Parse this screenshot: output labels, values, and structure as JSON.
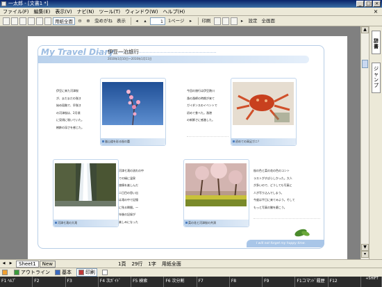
{
  "window": {
    "title": "一太郎 - [文書1 *]"
  },
  "menu": [
    "ファイル(F)",
    "編集(E)",
    "表示(V)",
    "ナビ(N)",
    "ツール(T)",
    "ウィンドウ(W)",
    "ヘルプ(H)"
  ],
  "toolbar": {
    "view_select": "用紙全面",
    "kana_search": "虫めがね",
    "display": "表示",
    "page_current": "1",
    "page_total": "1ページ",
    "print": "印刷",
    "settings": "設定",
    "full_screen": "全画面"
  },
  "side_panel": {
    "tab_dictionary": "辞書",
    "tab_jump": "ジャンプ"
  },
  "document": {
    "title": "My Travel Diary",
    "tagline": "I will not forget my happy time.",
    "subtitle": "伊豆一泊旅行",
    "date": "2010年1月10日～2010年1月11日",
    "blocks": [
      {
        "caption": "嵐山道を彩る桜の蕾",
        "text": [
          "伊豆に来た河津桜",
          "が、まだまだの咲き",
          "始め段階で、早咲き",
          "の河津桜は、2月頃",
          "に見頃に咲いていた。",
          "樹齢の深さを感じた。"
        ]
      },
      {
        "caption": "初めての高足ガニ？",
        "text": [
          "今回の旅行は伊豆熱川",
          "漁の漁師の時期が来て",
          "ガイダンスのイベントで",
          "初めて食べた。漁港",
          "の新鮮さに感激した。"
        ]
      },
      {
        "caption": "河津七滝の大滝",
        "text": [
          "河津七滝の流れの中",
          "での緑に温泉",
          "旅情を楽しんだ",
          "二日目の思い出",
          "は滝の中で記憶",
          "に残る瞬間。一",
          "年後の記録が",
          "楽しみになった"
        ]
      },
      {
        "caption": "菜の花と河津桜の共演",
        "text": [
          "桜の色と菜の花の色のコント",
          "ラストがすばらしかった。大人",
          "が多いので、どうしても写真に",
          "人が写り込んでしまう。",
          "今度は平日に来てみよう。そして",
          "もっと写真の腕を磨こう。"
        ]
      }
    ],
    "footer_tagline": "I will not forget my happy time."
  },
  "tabbar": {
    "sheet": "Sheet1",
    "new": "New",
    "status": [
      "1頁",
      "29行",
      "1字",
      "用紙全面"
    ]
  },
  "viewbar": [
    "アウトライン",
    "基本",
    "印刷"
  ],
  "fkeys": [
    "ﾍﾙﾌﾟ",
    "",
    "",
    "次ｶﾞｲﾄﾞ",
    "F5 検索",
    "F6 次分割",
    "",
    "",
    "",
    "F1コマﾝﾄﾞ履歴",
    "",
    "+SHIFT"
  ]
}
